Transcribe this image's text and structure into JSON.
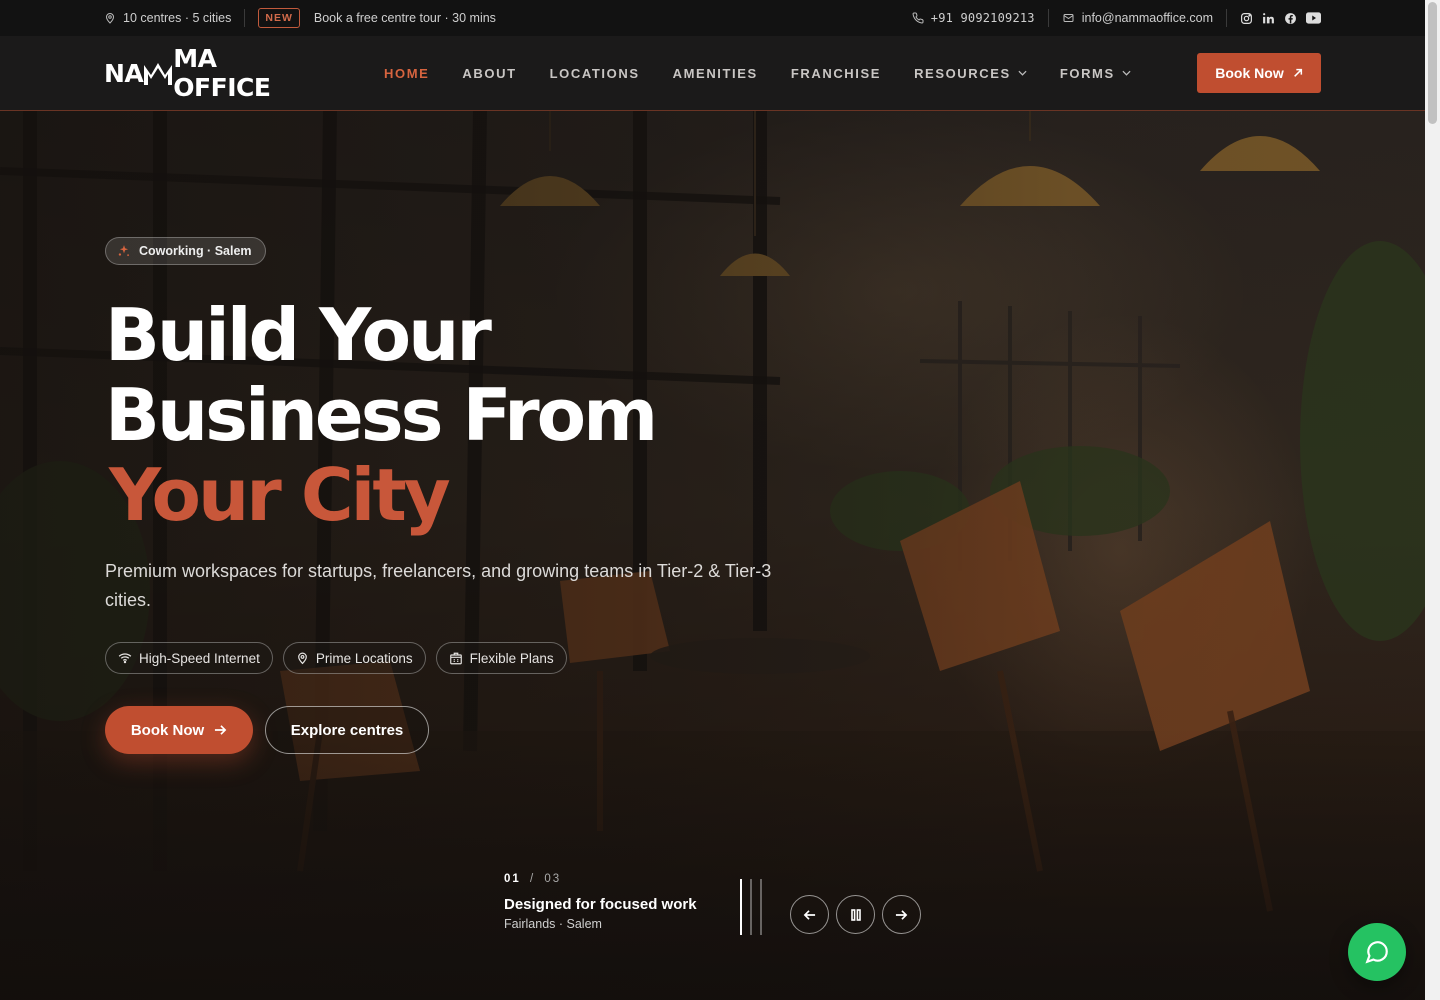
{
  "topbar": {
    "centres": "10 centres · 5 cities",
    "new_badge": "NEW",
    "tour": "Book a free centre tour · 30 mins",
    "phone": "+91 9092109213",
    "email": "info@nammaoffice.com",
    "socials": [
      "instagram-icon",
      "linkedin-icon",
      "facebook-icon",
      "youtube-icon"
    ]
  },
  "header": {
    "logo_left": "NA",
    "logo_right": "MA OFFICE",
    "nav": [
      {
        "label": "HOME",
        "active": true
      },
      {
        "label": "ABOUT"
      },
      {
        "label": "LOCATIONS"
      },
      {
        "label": "AMENITIES"
      },
      {
        "label": "FRANCHISE"
      },
      {
        "label": "RESOURCES",
        "dropdown": true
      },
      {
        "label": "FORMS",
        "dropdown": true
      }
    ],
    "book_label": "Book Now"
  },
  "hero": {
    "tag": "Coworking · Salem",
    "headline_line1": "Build Your",
    "headline_line2": "Business From",
    "headline_accent": "Your City",
    "subtext": "Premium workspaces for startups, freelancers, and growing teams in Tier-2 & Tier-3 cities.",
    "features": [
      {
        "icon": "wifi-icon",
        "label": "High-Speed Internet"
      },
      {
        "icon": "location-pin-icon",
        "label": "Prime Locations"
      },
      {
        "icon": "building-icon",
        "label": "Flexible Plans"
      }
    ],
    "primary_cta": "Book Now",
    "secondary_cta": "Explore centres"
  },
  "slider": {
    "current": "01",
    "separator": "/",
    "total": "03",
    "title": "Designed for focused work",
    "subtitle": "Fairlands · Salem",
    "active_index": 0
  },
  "colors": {
    "accent": "#c04e30",
    "accent_text": "#d7643f",
    "whatsapp": "#25c262",
    "topbar_bg": "#121212",
    "header_bg": "#1b1a1a"
  }
}
